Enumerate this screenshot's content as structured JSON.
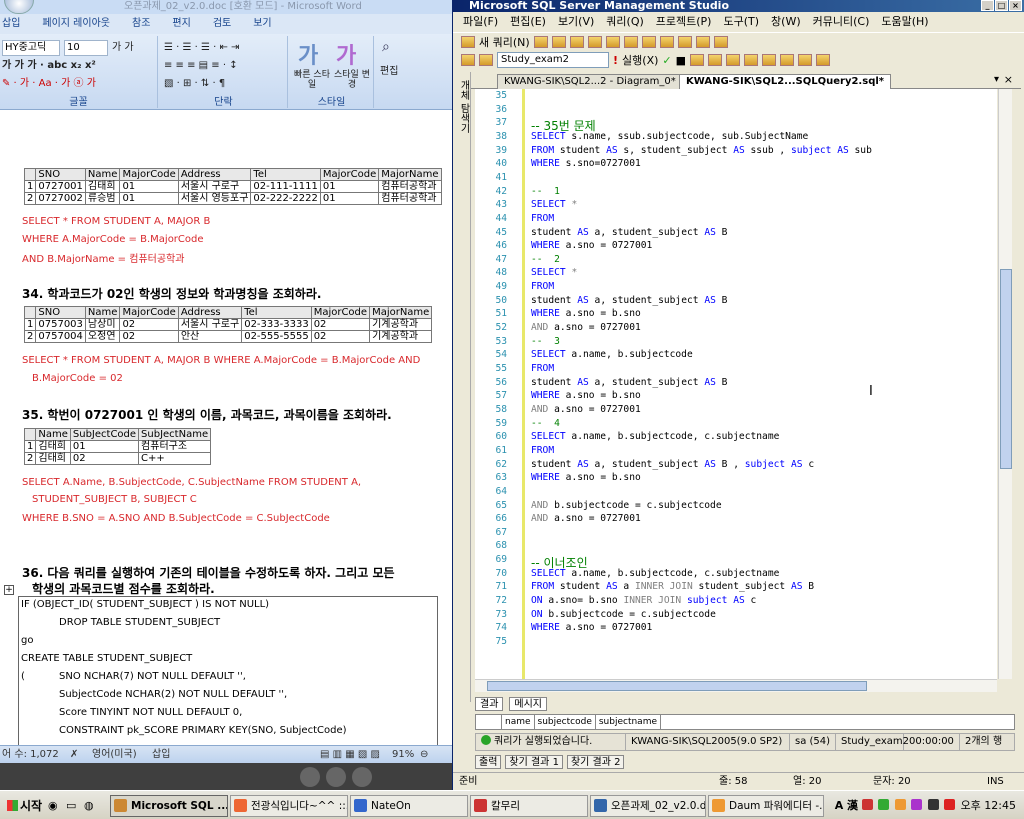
{
  "word": {
    "title": "오픈과제_02_v2.0.doc [호환 모드] - Microsoft Word",
    "tabs": [
      "삽입",
      "페이지 레이아웃",
      "참조",
      "편지",
      "검토",
      "보기"
    ],
    "font_name": "HY중고딕",
    "font_size": "10",
    "group_labels": {
      "font": "글꼴",
      "paragraph": "단락",
      "style": "스타일"
    },
    "style_buttons": {
      "quick": "빠른 스타일",
      "change": "스타일 변경",
      "edit": "편집"
    },
    "t1": {
      "headers": [
        "SNO",
        "Name",
        "MajorCode",
        "Address",
        "Tel",
        "MajorCode",
        "MajorName"
      ],
      "rows": [
        [
          "1",
          "0727001",
          "김태희",
          "01",
          "서울시 구로구",
          "02-111-1111",
          "01",
          "컴퓨터공학과"
        ],
        [
          "2",
          "0727002",
          "류승범",
          "01",
          "서울시 영등포구",
          "02-222-2222",
          "01",
          "컴퓨터공학과"
        ]
      ]
    },
    "sql1": [
      "SELECT * FROM STUDENT A, MAJOR B",
      "WHERE A.MajorCode = B.MajorCode",
      "AND B.MajorName = 컴퓨터공학과"
    ],
    "q34": "34. 학과코드가 02인 학생의 정보와 학과명칭을 조회하라.",
    "t2": {
      "headers": [
        "SNO",
        "Name",
        "MajorCode",
        "Address",
        "Tel",
        "MajorCode",
        "MajorName"
      ],
      "rows": [
        [
          "1",
          "0757003",
          "남상미",
          "02",
          "서울시 구로구",
          "02-333-3333",
          "02",
          "기계공학과"
        ],
        [
          "2",
          "0757004",
          "오정연",
          "02",
          "안산",
          "02-555-5555",
          "02",
          "기계공학과"
        ]
      ]
    },
    "sql2": [
      "SELECT * FROM STUDENT A, MAJOR B WHERE A.MajorCode = B.MajorCode AND",
      "B.MajorCode = 02"
    ],
    "q35": "35. 학번이 0727001 인 학생의 이름, 과목코드, 과목이름을 조회하라.",
    "t3": {
      "headers": [
        "Name",
        "SubJectCode",
        "SubJectName"
      ],
      "rows": [
        [
          "1",
          "김태희",
          "01",
          "컴퓨터구조"
        ],
        [
          "2",
          "김태희",
          "02",
          "C++"
        ]
      ]
    },
    "sql3": [
      "SELECT   A.Name,   B.SubjectCode,   C.SubjectName   FROM   STUDENT   A,",
      "STUDENT_SUBJECT B, SUBJECT C",
      "WHERE  B.SNO  =  A.SNO  AND  B.SubJectCode  =  C.SubJectCode"
    ],
    "q36": [
      "36. 다음 쿼리를 실행하여 기존의 테이블을 수정하도록 하자. 그리고 모든",
      "학생의 과목코드별 점수를 조회하라."
    ],
    "codebox": [
      "IF (OBJECT_ID( STUDENT_SUBJECT ) IS NOT NULL)",
      "DROP TABLE STUDENT_SUBJECT",
      "go",
      "CREATE              TABLE  STUDENT_SUBJECT",
      "(",
      "SNO NCHAR(7) NOT NULL DEFAULT '',",
      "SubjectCode NCHAR(2) NOT NULL DEFAULT '',",
      "Score TINYINT NOT NULL DEFAULT 0,",
      "CONSTRAINT pk_SCORE PRIMARY KEY(SNO, SubjectCode)"
    ],
    "status": {
      "words": "어 수: 1,072",
      "lang": "영어(미국)",
      "mode": "삽입",
      "zoom": "91%"
    }
  },
  "ssms": {
    "title": "Microsoft SQL Server Management Studio",
    "menu": [
      "파일(F)",
      "편집(E)",
      "보기(V)",
      "쿼리(Q)",
      "프로젝트(P)",
      "도구(T)",
      "창(W)",
      "커뮤니티(C)",
      "도움말(H)"
    ],
    "new_query": "새 쿼리(N)",
    "database": "Study_exam2",
    "execute": "실행(X)",
    "object_explorer": "개체 탐색기",
    "tabs": [
      "KWANG-SIK\\SQL2...2 - Diagram_0*",
      "KWANG-SIK\\SQL2...SQLQuery2.sql*"
    ],
    "lines": [
      {
        "n": "35",
        "t": ""
      },
      {
        "n": "36",
        "t": ""
      },
      {
        "n": "37",
        "t": "-- 35번 문제"
      },
      {
        "n": "38",
        "t": "SELECT s.name, ssub.subjectcode, sub.SubjectName"
      },
      {
        "n": "39",
        "t": "FROM student AS s, student_subject AS ssub , subject AS sub"
      },
      {
        "n": "40",
        "t": "WHERE s.sno=0727001"
      },
      {
        "n": "41",
        "t": ""
      },
      {
        "n": "42",
        "t": "--  1"
      },
      {
        "n": "43",
        "t": "SELECT *"
      },
      {
        "n": "44",
        "t": "FROM"
      },
      {
        "n": "45",
        "t": "student AS a, student_subject AS B"
      },
      {
        "n": "46",
        "t": "WHERE a.sno = 0727001"
      },
      {
        "n": "47",
        "t": "--  2"
      },
      {
        "n": "48",
        "t": "SELECT *"
      },
      {
        "n": "49",
        "t": "FROM"
      },
      {
        "n": "50",
        "t": "student AS a, student_subject AS B"
      },
      {
        "n": "51",
        "t": "WHERE a.sno = b.sno"
      },
      {
        "n": "52",
        "t": "AND a.sno = 0727001"
      },
      {
        "n": "53",
        "t": "--  3"
      },
      {
        "n": "54",
        "t": "SELECT a.name, b.subjectcode"
      },
      {
        "n": "55",
        "t": "FROM"
      },
      {
        "n": "56",
        "t": "student AS a, student_subject AS B"
      },
      {
        "n": "57",
        "t": "WHERE a.sno = b.sno"
      },
      {
        "n": "58",
        "t": "AND a.sno = 0727001"
      },
      {
        "n": "59",
        "t": "--  4"
      },
      {
        "n": "60",
        "t": "SELECT a.name, b.subjectcode, c.subjectname"
      },
      {
        "n": "61",
        "t": "FROM"
      },
      {
        "n": "62",
        "t": "student AS a, student_subject AS B , subject AS c"
      },
      {
        "n": "63",
        "t": "WHERE a.sno = b.sno"
      },
      {
        "n": "64",
        "t": ""
      },
      {
        "n": "65",
        "t": "AND b.subjectcode = c.subjectcode"
      },
      {
        "n": "66",
        "t": "AND a.sno = 0727001"
      },
      {
        "n": "67",
        "t": ""
      },
      {
        "n": "68",
        "t": ""
      },
      {
        "n": "69",
        "t": "-- 이너조인"
      },
      {
        "n": "70",
        "t": "SELECT a.name, b.subjectcode, c.subjectname"
      },
      {
        "n": "71",
        "t": "FROM student AS a INNER JOIN student_subject AS B"
      },
      {
        "n": "72",
        "t": "ON a.sno= b.sno INNER JOIN subject AS c"
      },
      {
        "n": "73",
        "t": "ON b.subjectcode = c.subjectcode"
      },
      {
        "n": "74",
        "t": "WHERE a.sno = 0727001"
      },
      {
        "n": "75",
        "t": ""
      }
    ],
    "result_tabs": [
      "결과",
      "메시지"
    ],
    "result_cols": [
      "name",
      "subjectcode",
      "subjectname"
    ],
    "exec_status": [
      "쿼리가 실행되었습니다.",
      "KWANG-SIK\\SQL2005(9.0 SP2)",
      "sa (54)",
      "Study_exam2",
      "00:00:00",
      "2개의 행"
    ],
    "out_tabs": [
      "출력",
      "찾기 결과 1",
      "찾기 결과 2"
    ],
    "status": {
      "ready": "준비",
      "line": "줄: 58",
      "col": "열: 20",
      "char": "문자: 20",
      "ins": "INS"
    }
  },
  "taskbar": {
    "start": "시작",
    "items": [
      "Microsoft SQL ...",
      "전광식입니다~^^ ::...",
      "NateOn",
      "칼무리",
      "오픈과제_02_v2.0.d...",
      "Daum 파워에디터 -..."
    ],
    "clock": "오후 12:45"
  }
}
